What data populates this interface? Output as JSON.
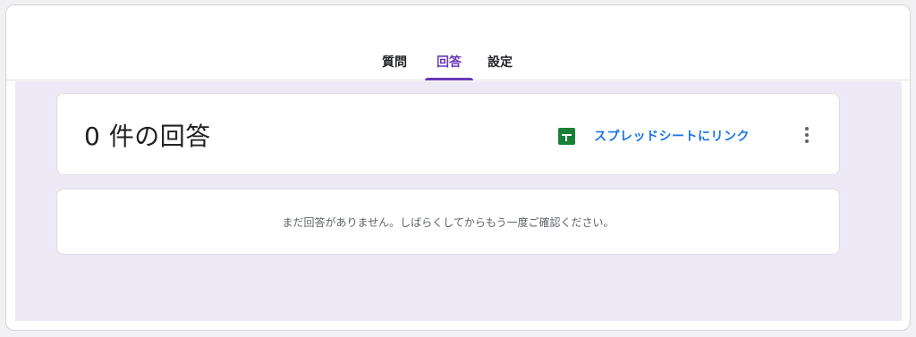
{
  "tabs": {
    "questions": "質問",
    "responses": "回答",
    "settings": "設定",
    "active": "回答"
  },
  "summary": {
    "response_count": "0 件の回答",
    "link_sheets_label": "スプレッドシートにリンク",
    "sheets_icon": "google-sheets-icon",
    "more_icon": "more-vert-icon"
  },
  "empty_state": {
    "message": "まだ回答がありません。しばらくしてからもう一度ご確認ください。"
  },
  "colors": {
    "accent": "#673ab7",
    "link": "#1a73e8",
    "sheets_green": "#188038",
    "background": "#ede9f7"
  }
}
